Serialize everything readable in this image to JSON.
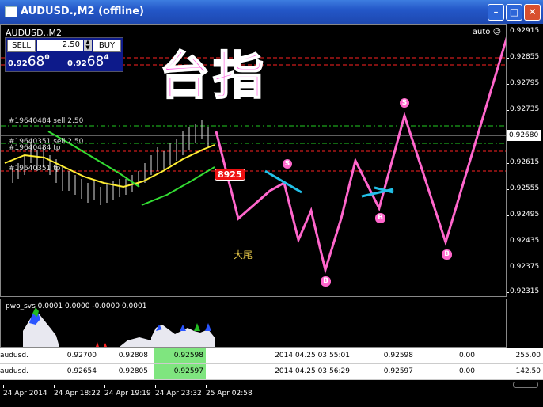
{
  "window": {
    "title": "AUDUSD.,M2 (offline)",
    "min_label": "–",
    "max_label": "□",
    "close_label": "✕"
  },
  "chart": {
    "symbol_label": "AUDUSD.,M2",
    "auto_label": "auto ☺",
    "overlay_title": "台指",
    "tail_text": "大尾",
    "price_tag": "8925",
    "marker_s": "S",
    "marker_b": "B",
    "orders": [
      "#19640484 sell 2.50",
      "#19640351 sell 2.50",
      "#19640484 tp",
      "#19640351 tp"
    ]
  },
  "trade_panel": {
    "sell_label": "SELL",
    "buy_label": "BUY",
    "lot": "2.50",
    "sell_prefix": "0.92",
    "sell_big": "68",
    "sell_sup": "0",
    "buy_prefix": "0.92",
    "buy_big": "68",
    "buy_sup": "4"
  },
  "price_axis": {
    "ticks": [
      "0.92915",
      "0.92855",
      "0.92795",
      "0.92735",
      "0.92675",
      "0.92615",
      "0.92555",
      "0.92495",
      "0.92435",
      "0.92375",
      "0.92315"
    ],
    "current": "0.92680"
  },
  "indicator": {
    "label": "pwo_svs 0.0001 0.0000 -0.0000 0.0001"
  },
  "orders_table": {
    "rows": [
      [
        "audusd.",
        "0.92700",
        "0.92808",
        "0.92598",
        "2014.04.25 03:55:01",
        "0.92598",
        "0.00",
        "255.00"
      ],
      [
        "audusd.",
        "0.92654",
        "0.92805",
        "0.92597",
        "2014.04.25 03:56:29",
        "0.92597",
        "0.00",
        "142.50"
      ]
    ]
  },
  "time_axis": {
    "labels": [
      "24 Apr 2014",
      "24 Apr 18:22",
      "24 Apr 19:19",
      "24 Apr 23:32",
      "25 Apr 02:58"
    ]
  },
  "colors": {
    "pink": "#ff66cc",
    "cyan": "#22c0e8",
    "accent_red": "#ff2222",
    "green_cell": "#7fe57f"
  }
}
